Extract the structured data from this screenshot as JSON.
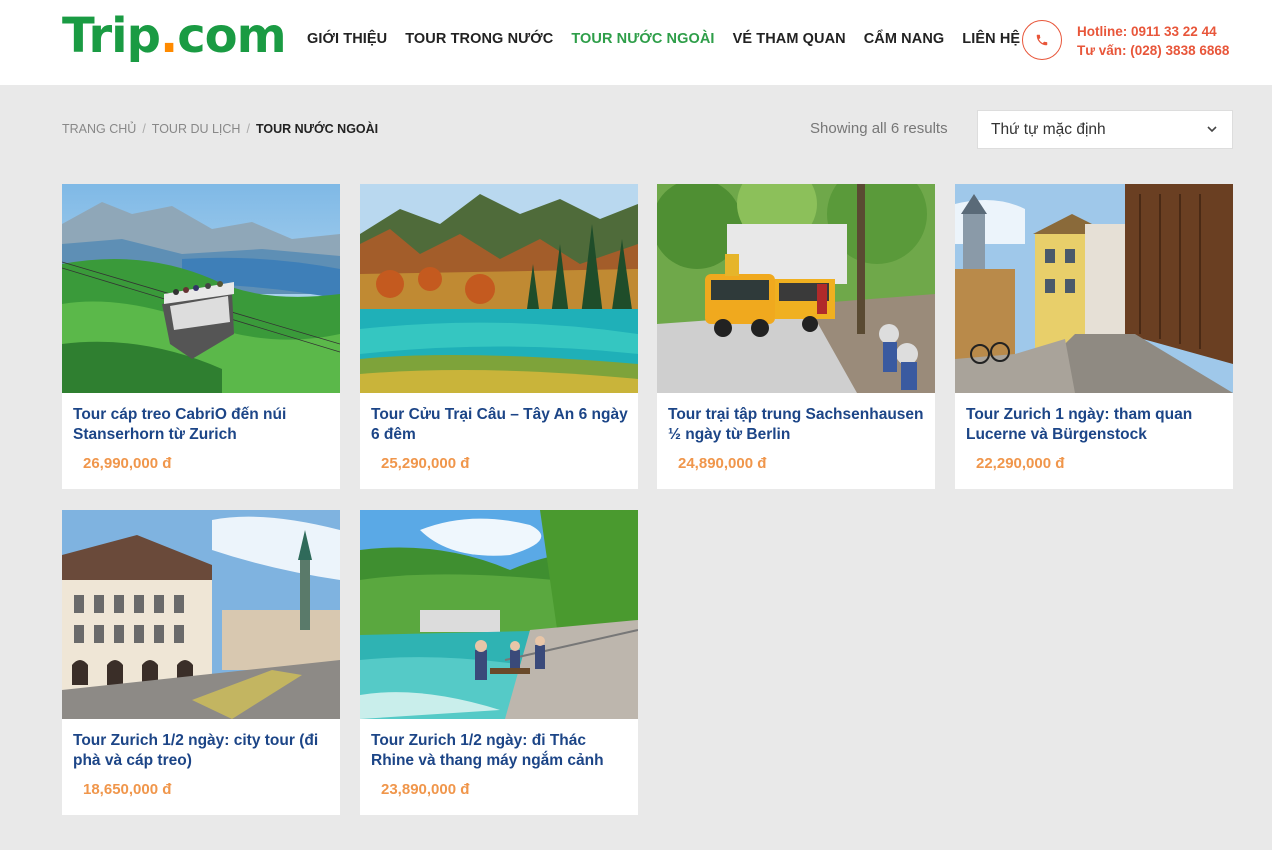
{
  "brand": {
    "part1": "Trip",
    "dot": ".",
    "part2": "com"
  },
  "nav": [
    {
      "label": "GIỚI THIỆU"
    },
    {
      "label": "TOUR TRONG NƯỚC"
    },
    {
      "label": "TOUR NƯỚC NGOÀI",
      "active": true
    },
    {
      "label": "VÉ THAM QUAN"
    },
    {
      "label": "CẨM NANG"
    },
    {
      "label": "LIÊN HỆ"
    }
  ],
  "contact": {
    "hotline": "Hotline: 0911 33 22 44",
    "consult": "Tư vấn: (028) 3838 6868",
    "icon": "phone-icon"
  },
  "breadcrumb": {
    "home": "TRANG CHỦ",
    "parent": "TOUR DU LỊCH",
    "current": "TOUR NƯỚC NGOÀI"
  },
  "results_text": "Showing all 6 results",
  "sort": {
    "selected": "Thứ tự mặc định"
  },
  "products": [
    {
      "title": "Tour cáp treo CabriO đến núi Stanserhorn từ Zurich",
      "price": "26,990,000 đ"
    },
    {
      "title": "Tour Cửu Trại Câu – Tây An 6 ngày 6 đêm",
      "price": "25,290,000 đ"
    },
    {
      "title": "Tour trại tập trung Sachsenhausen ½ ngày từ Berlin",
      "price": "24,890,000 đ"
    },
    {
      "title": "Tour Zurich 1 ngày: tham quan Lucerne và Bürgenstock",
      "price": "22,290,000 đ"
    },
    {
      "title": "Tour Zurich 1/2 ngày: city tour (đi phà và cáp treo)",
      "price": "18,650,000 đ"
    },
    {
      "title": "Tour Zurich 1/2 ngày: đi Thác Rhine và thang máy ngắm cảnh",
      "price": "23,890,000 đ"
    }
  ],
  "colors": {
    "brand_green": "#1a9b43",
    "brand_orange": "#ff8a00",
    "accent_red": "#e8563a",
    "title_blue": "#1c4587",
    "price_orange": "#f0964b"
  }
}
